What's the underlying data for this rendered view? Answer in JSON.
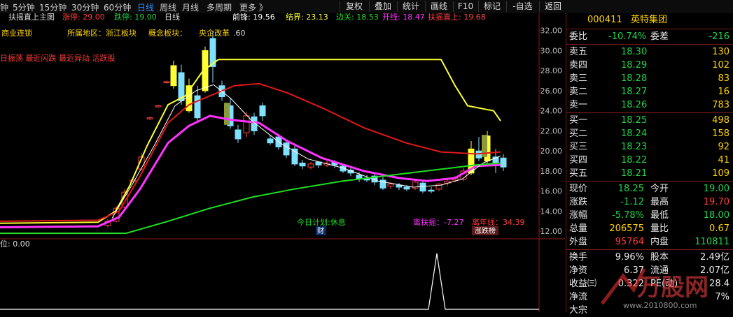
{
  "toolbar": {
    "periods": [
      "钟",
      "5分钟",
      "15分钟",
      "30分钟",
      "60分钟",
      "日线",
      "周线",
      "月线",
      "多周期",
      "更多 》"
    ],
    "active_period": "日线",
    "buttons": [
      "复权",
      "叠加",
      "统计",
      "画线",
      "F10",
      "标记",
      "-自选",
      "返回"
    ]
  },
  "main_header": {
    "indicator": "扶摇直上主图",
    "limit_up_label": "涨停: 29.00",
    "limit_down_label": "跌停: 19.00",
    "period": "日线",
    "qianfeng": "前锋: 19.56",
    "jiejie": "结界: 23.13",
    "bianguan": "边关: 18.53",
    "kaixian": "开线: 18.47",
    "fuyao": "扶摇直上: 19.68"
  },
  "info_lines": {
    "industry": "商业连锁",
    "region": "所属地区：浙江板块",
    "concept": "概念板块：",
    "concept_value": "央企改革",
    "price_tag": ".60",
    "tags": "日振荡  最近闪跌  最近异动  活跃股"
  },
  "y_axis": [
    "32.00",
    "30.00",
    "28.00",
    "26.00",
    "24.00",
    "22.00",
    "20.00",
    "18.00",
    "16.00",
    "14.00",
    "12.00"
  ],
  "bottom_labels": {
    "plan": "今日计划:休息",
    "cai": "财",
    "li_fuyao": "离扶摇：-7.27",
    "li_nianxian": "离年线：34.39",
    "zhangdiebang": "涨跌榜"
  },
  "sub_chart": {
    "label": "位: 0.00"
  },
  "quote": {
    "code": "000411",
    "name": "英特集团",
    "weibi_label": "委比",
    "weibi": "-10.74%",
    "weicha_label": "委差",
    "weicha": "-216",
    "asks": [
      {
        "label": "卖五",
        "price": "18.30",
        "vol": "130"
      },
      {
        "label": "卖四",
        "price": "18.29",
        "vol": "102"
      },
      {
        "label": "卖三",
        "price": "18.28",
        "vol": "83"
      },
      {
        "label": "卖二",
        "price": "18.27",
        "vol": "16"
      },
      {
        "label": "卖一",
        "price": "18.26",
        "vol": "783"
      }
    ],
    "bids": [
      {
        "label": "买一",
        "price": "18.25",
        "vol": "498"
      },
      {
        "label": "买二",
        "price": "18.24",
        "vol": "158"
      },
      {
        "label": "买三",
        "price": "18.23",
        "vol": "92"
      },
      {
        "label": "买四",
        "price": "18.22",
        "vol": "41"
      },
      {
        "label": "买五",
        "price": "18.21",
        "vol": "109"
      }
    ],
    "stats": [
      {
        "l1": "现价",
        "v1": "18.25",
        "c1": "dn",
        "l2": "今开",
        "v2": "19.00",
        "c2": "dn"
      },
      {
        "l1": "涨跌",
        "v1": "-1.12",
        "c1": "dn",
        "l2": "最高",
        "v2": "19.70",
        "c2": "up"
      },
      {
        "l1": "涨幅",
        "v1": "-5.78%",
        "c1": "dn",
        "l2": "最低",
        "v2": "18.00",
        "c2": "dn"
      },
      {
        "l1": "总量",
        "v1": "206575",
        "c1": "yl",
        "l2": "量比",
        "v2": "0.67",
        "c2": "yl"
      },
      {
        "l1": "外盘",
        "v1": "95764",
        "c1": "up",
        "l2": "内盘",
        "v2": "110811",
        "c2": "dn"
      }
    ],
    "stats2": [
      {
        "l1": "换手",
        "v1": "9.96%",
        "l2": "股本",
        "v2": "2.49亿"
      },
      {
        "l1": "净资",
        "v1": "6.37",
        "l2": "流通",
        "v2": "2.07亿"
      },
      {
        "l1": "收益㈢",
        "v1": "0.322",
        "l2": "PE(动)",
        "v2": "28.4"
      },
      {
        "l1": "净流",
        "v1": "",
        "l2": "",
        "v2": "7%"
      },
      {
        "l1": "大宗",
        "v1": "",
        "l2": "",
        "v2": ""
      }
    ]
  },
  "watermark": {
    "text": "万股网",
    "url": "www.2010800.com"
  },
  "colors": {
    "yellow": "#ffff33",
    "red": "#e01818",
    "magenta": "#ff33ff",
    "green": "#22dd22",
    "white": "#ffffff",
    "cyan": "#7fe0ff"
  }
}
